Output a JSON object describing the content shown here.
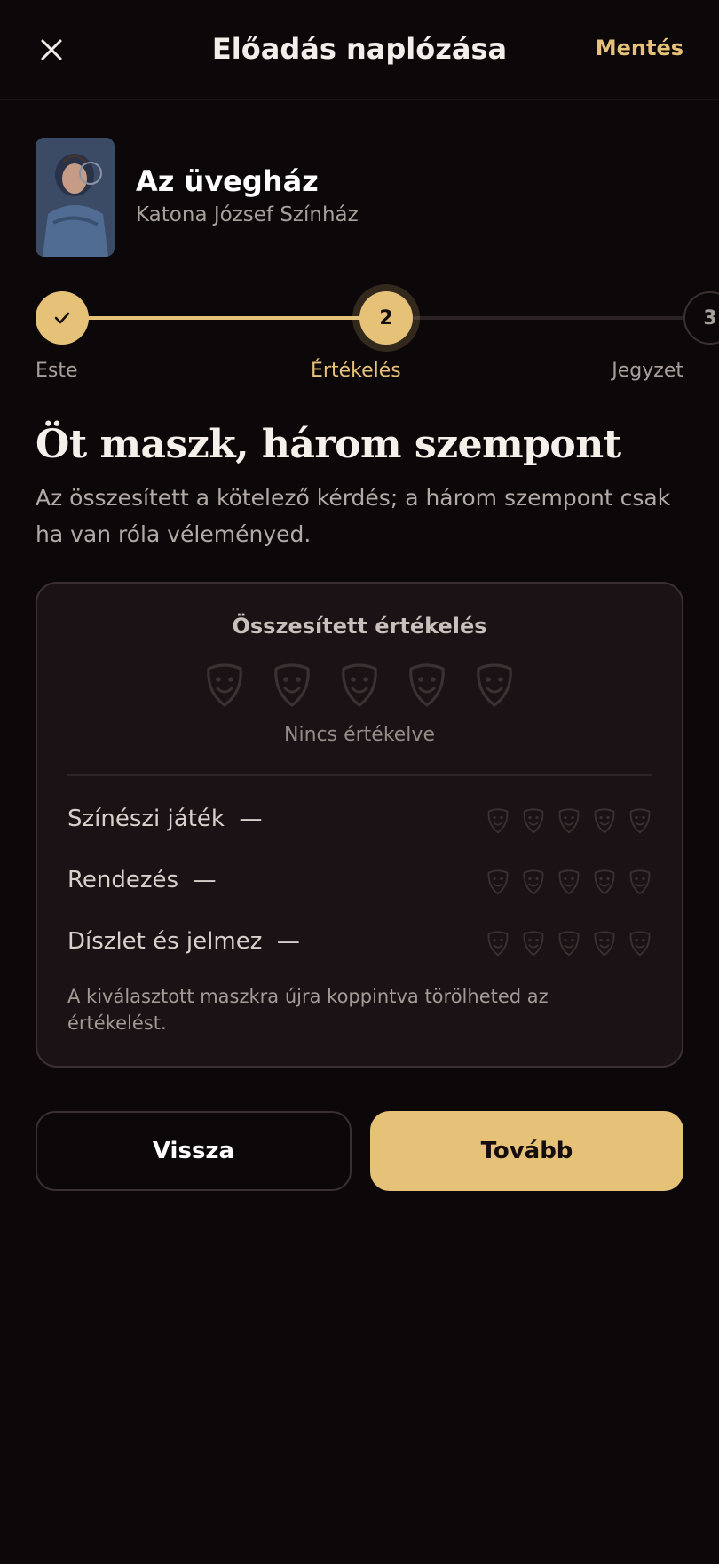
{
  "header": {
    "title": "Előadás naplózása",
    "save_label": "Mentés",
    "close_icon": "close-icon"
  },
  "show": {
    "title": "Az üvegház",
    "venue": "Katona József Színház"
  },
  "stepper": {
    "current_step": 2,
    "steps": [
      {
        "number": "1",
        "label": "Este",
        "state": "done"
      },
      {
        "number": "2",
        "label": "Értékelés",
        "state": "active"
      },
      {
        "number": "3",
        "label": "Jegyzet",
        "state": "upcoming"
      }
    ]
  },
  "section": {
    "heading": "Öt maszk, három szempont",
    "description": "Az összesített a kötelező kérdés; a három szempont csak ha van róla véleményed."
  },
  "rating_card": {
    "overall_title": "Összesített értékelés",
    "overall_status": "Nincs értékelve",
    "overall_value": 0,
    "max_masks": 5,
    "aspects": [
      {
        "label": "Színészi játék",
        "value_display": "—",
        "value": 0
      },
      {
        "label": "Rendezés",
        "value_display": "—",
        "value": 0
      },
      {
        "label": "Díszlet és jelmez",
        "value_display": "—",
        "value": 0
      }
    ],
    "hint": "A kiválasztott maszkra újra koppintva törölheted az értékelést."
  },
  "actions": {
    "back_label": "Vissza",
    "next_label": "Tovább"
  },
  "colors": {
    "accent": "#e6c279",
    "background": "#0c0708",
    "card": "#1a1214",
    "mask_inactive": "#3a3133"
  }
}
